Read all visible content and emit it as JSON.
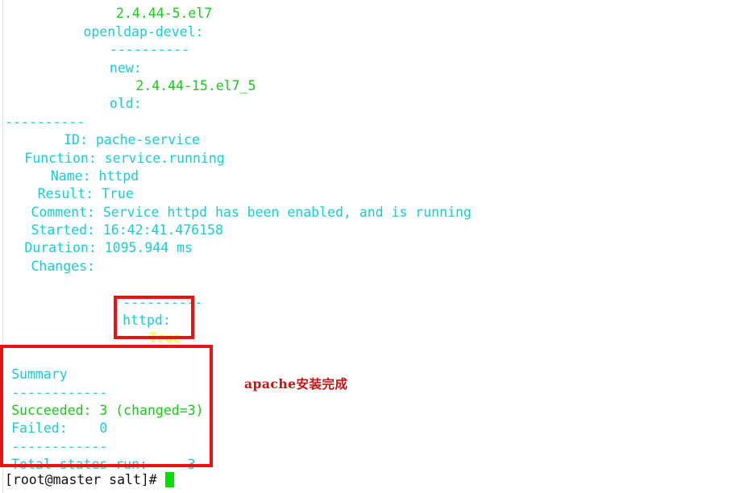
{
  "terminal": {
    "hostname": "master",
    "user": "root",
    "cwd": "salt",
    "prompt": "[root@master salt]# ",
    "colors": {
      "cyan": "#15cfd4",
      "green": "#16cc16",
      "yellow": "#ffff2e",
      "black": "#101010",
      "background": "#ffffff",
      "annotation_red": "#ee1111"
    },
    "lines": [
      {
        "indent": 14,
        "text": "old:",
        "color": "cyan",
        "clipped": true
      },
      {
        "indent": 17,
        "text": "2.4.44-5.el7",
        "color": "green"
      },
      {
        "indent": 12,
        "text": "openldap-devel:",
        "color": "cyan"
      },
      {
        "indent": 16,
        "text": "----------",
        "color": "cyan"
      },
      {
        "indent": 16,
        "text": "new:",
        "color": "cyan"
      },
      {
        "indent": 20,
        "text": "2.4.44-15.el7_5",
        "color": "green"
      },
      {
        "indent": 16,
        "text": "old:",
        "color": "cyan"
      },
      {
        "indent": 0,
        "text": "----------",
        "color": "cyan"
      },
      {
        "indent": 9,
        "text": "ID: pache-service",
        "color": "cyan"
      },
      {
        "indent": 3,
        "text": "Function: service.running",
        "color": "cyan"
      },
      {
        "indent": 7,
        "text": "Name: httpd",
        "color": "cyan"
      },
      {
        "indent": 5,
        "text": "Result: True",
        "color": "cyan"
      },
      {
        "indent": 4,
        "text": "Comment: Service httpd has been enabled, and is running",
        "color": "cyan"
      },
      {
        "indent": 4,
        "text": "Started: 16:42:41.476158",
        "color": "cyan"
      },
      {
        "indent": 3,
        "text": "Duration: 1095.944 ms",
        "color": "cyan"
      },
      {
        "indent": 4,
        "text": "Changes:",
        "color": "cyan"
      },
      {
        "indent": 0,
        "text": "",
        "color": "cyan"
      },
      {
        "indent": 18,
        "text": "----------",
        "color": "cyan"
      },
      {
        "indent": 18,
        "text": "httpd:",
        "color": "cyan"
      },
      {
        "indent": 22,
        "text": "True",
        "color": "yellow"
      },
      {
        "indent": 0,
        "text": "",
        "color": "cyan"
      },
      {
        "indent": 1,
        "text": "Summary",
        "color": "cyan"
      },
      {
        "indent": 1,
        "text": "------------",
        "color": "cyan"
      },
      {
        "indent": 1,
        "text": "Succeeded: 3 (changed=3)",
        "color": "green"
      },
      {
        "indent": 1,
        "text": "Failed:    0",
        "color": "cyan"
      },
      {
        "indent": 1,
        "text": "------------",
        "color": "cyan"
      },
      {
        "indent": 1,
        "text": "Total states run:     3",
        "color": "cyan"
      }
    ]
  },
  "summary": {
    "heading": "Summary",
    "succeeded_label": "Succeeded:",
    "succeeded_value": "3",
    "changed_note": "(changed=3)",
    "failed_label": "Failed:",
    "failed_value": "0",
    "total_label": "Total states run:",
    "total_value": "3"
  },
  "state_result": {
    "id": "pache-service",
    "function": "service.running",
    "name": "httpd",
    "result": "True",
    "comment": "Service httpd has been enabled, and is running",
    "started": "16:42:41.476158",
    "duration": "1095.944 ms",
    "changes_key": "httpd:",
    "changes_value": "True"
  },
  "packages": {
    "openldap_devel": {
      "new": "2.4.44-15.el7_5",
      "old": ""
    },
    "previous_old": "2.4.44-5.el7"
  },
  "annotations": [
    {
      "name": "httpd-changes-highlight",
      "label": ""
    },
    {
      "name": "summary-highlight",
      "label": ""
    },
    {
      "name": "apache-note",
      "label": "apache安装完成"
    }
  ]
}
